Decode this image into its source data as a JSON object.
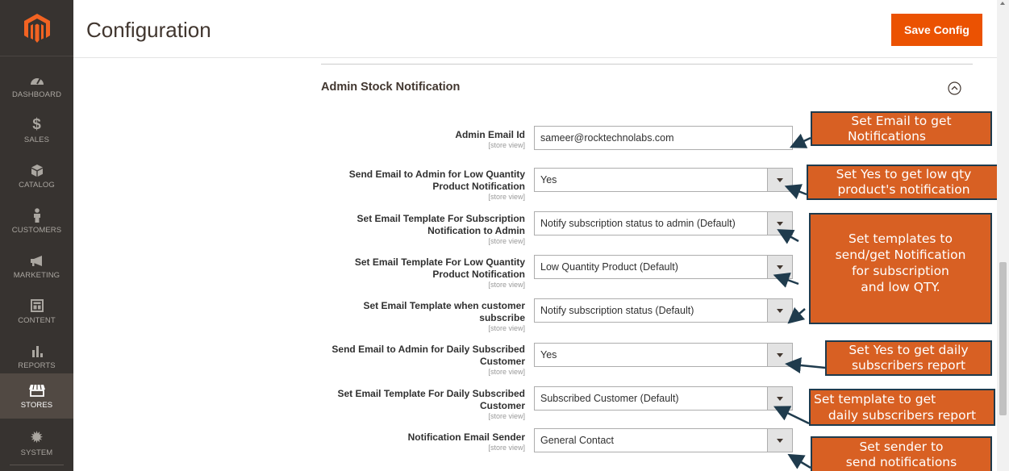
{
  "header": {
    "title": "Configuration",
    "save_label": "Save Config"
  },
  "sidebar": {
    "items": [
      {
        "label": "DASHBOARD",
        "icon": "dashboard-icon"
      },
      {
        "label": "SALES",
        "icon": "dollar-icon"
      },
      {
        "label": "CATALOG",
        "icon": "cube-icon"
      },
      {
        "label": "CUSTOMERS",
        "icon": "person-icon"
      },
      {
        "label": "MARKETING",
        "icon": "megaphone-icon"
      },
      {
        "label": "CONTENT",
        "icon": "layout-icon"
      },
      {
        "label": "REPORTS",
        "icon": "bar-chart-icon"
      },
      {
        "label": "STORES",
        "icon": "store-icon",
        "active": true
      },
      {
        "label": "SYSTEM",
        "icon": "gear-icon"
      }
    ]
  },
  "section": {
    "title": "Admin Stock Notification"
  },
  "rows": [
    {
      "label1": "Admin Email Id",
      "label2": "",
      "scope": "[store view]",
      "value": "sameer@rocktechnolabs.com",
      "type": "text"
    },
    {
      "label1": "Send Email to Admin for Low Quantity",
      "label2": "Product Notification",
      "scope": "[store view]",
      "value": "Yes",
      "type": "select"
    },
    {
      "label1": "Set Email Template For Subscription",
      "label2": "Notification to Admin",
      "scope": "[store view]",
      "value": "Notify subscription status to admin (Default)",
      "type": "select"
    },
    {
      "label1": "Set Email Template For Low Quantity",
      "label2": "Product Notification",
      "scope": "[store view]",
      "value": "Low Quantity Product (Default)",
      "type": "select"
    },
    {
      "label1": "Set Email Template when customer",
      "label2": "subscribe",
      "scope": "[store view]",
      "value": "Notify subscription status (Default)",
      "type": "select"
    },
    {
      "label1": "Send Email to Admin for Daily Subscribed",
      "label2": "Customer",
      "scope": "[store view]",
      "value": "Yes",
      "type": "select"
    },
    {
      "label1": "Set Email Template For Daily Subscribed",
      "label2": "Customer",
      "scope": "[store view]",
      "value": "Subscribed Customer (Default)",
      "type": "select"
    },
    {
      "label1": "Notification Email Sender",
      "label2": "",
      "scope": "[store view]",
      "value": "General Contact",
      "type": "select"
    }
  ],
  "callouts": [
    {
      "lines": [
        "Set Email to get",
        "Notifications"
      ]
    },
    {
      "lines": [
        "Set Yes to get low qty",
        "product's notification"
      ]
    },
    {
      "lines": [
        "Set templates to",
        "send/get Notification",
        "for subscription",
        "and low QTY."
      ]
    },
    {
      "lines": [
        "Set Yes to get daily",
        "subscribers report"
      ]
    },
    {
      "lines": [
        "Set template to get",
        "daily subscribers report"
      ]
    },
    {
      "lines": [
        "Set sender to",
        "send notifications"
      ]
    }
  ],
  "colors": {
    "accent": "#eb5202",
    "sidebar": "#373330",
    "callout": "#d86023",
    "callout_border": "#1f3b4d"
  }
}
